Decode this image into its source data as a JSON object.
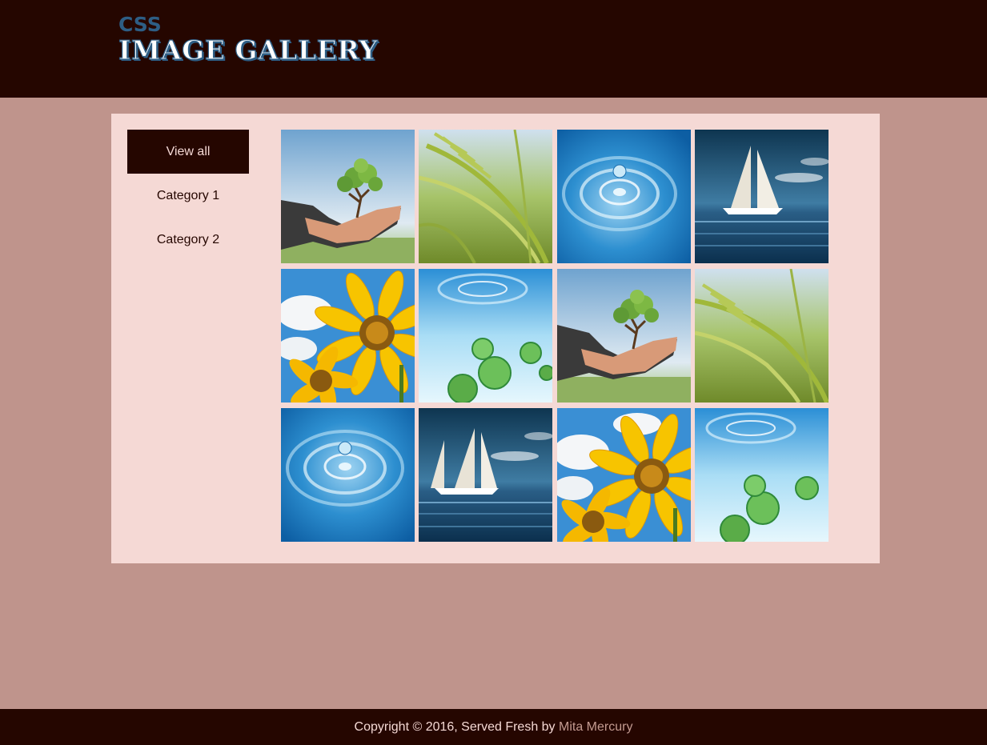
{
  "header": {
    "logo_small": "CSS",
    "logo_big": "IMAGE GALLERY"
  },
  "sidebar": {
    "items": [
      {
        "label": "View all",
        "active": true
      },
      {
        "label": "Category 1",
        "active": false
      },
      {
        "label": "Category 2",
        "active": false
      }
    ]
  },
  "gallery": {
    "images": [
      {
        "subject": "tree-in-hand"
      },
      {
        "subject": "wheat-field"
      },
      {
        "subject": "water-droplet"
      },
      {
        "subject": "sailboat"
      },
      {
        "subject": "sunflowers"
      },
      {
        "subject": "water-bubbles"
      },
      {
        "subject": "tree-in-hand"
      },
      {
        "subject": "wheat-field"
      },
      {
        "subject": "water-droplet"
      },
      {
        "subject": "sailboat"
      },
      {
        "subject": "sunflowers"
      },
      {
        "subject": "water-bubbles"
      }
    ]
  },
  "footer": {
    "copyright": "Copyright © 2016, Served Fresh by ",
    "author": "Mita Mercury"
  },
  "colors": {
    "background": "#bf948c",
    "header": "#250600",
    "panel": "#f5d9d5",
    "logo_accent": "#2e5e85",
    "footer_link": "#c39a90"
  }
}
